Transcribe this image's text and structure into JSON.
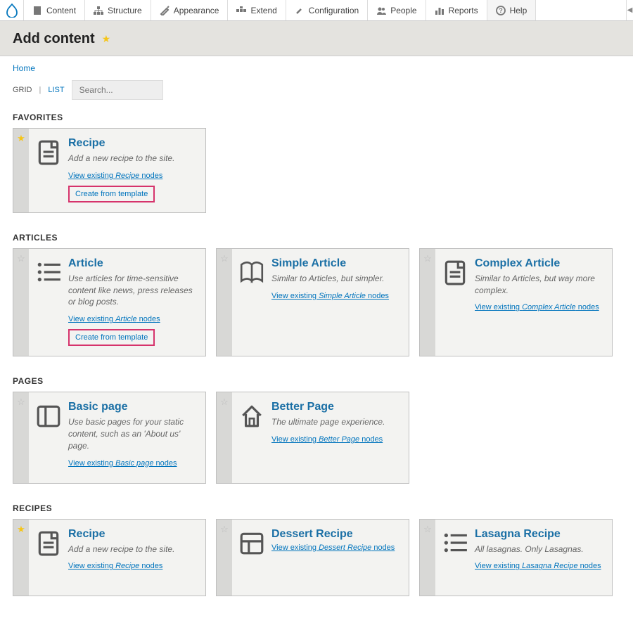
{
  "toolbar": {
    "items": [
      {
        "label": "Content",
        "icon": "file-icon"
      },
      {
        "label": "Structure",
        "icon": "structure-icon"
      },
      {
        "label": "Appearance",
        "icon": "appearance-icon"
      },
      {
        "label": "Extend",
        "icon": "extend-icon"
      },
      {
        "label": "Configuration",
        "icon": "config-icon"
      },
      {
        "label": "People",
        "icon": "people-icon"
      },
      {
        "label": "Reports",
        "icon": "reports-icon"
      },
      {
        "label": "Help",
        "icon": "help-icon"
      }
    ]
  },
  "page": {
    "title": "Add content",
    "breadcrumb_home": "Home",
    "view_grid": "GRID",
    "view_list": "LIST",
    "search_placeholder": "Search..."
  },
  "sections": [
    {
      "heading": "FAVORITES",
      "cards": [
        {
          "title": "Recipe",
          "desc": "Add a new recipe to the site.",
          "link_prefix": "View existing ",
          "link_em": "Recipe",
          "link_suffix": " nodes",
          "template": "Create from template",
          "favorited": true,
          "icon": "doc-icon"
        }
      ]
    },
    {
      "heading": "ARTICLES",
      "cards": [
        {
          "title": "Article",
          "desc": "Use articles for time-sensitive content like news, press releases or blog posts.",
          "link_prefix": "View existing ",
          "link_em": "Article",
          "link_suffix": " nodes",
          "template": "Create from template",
          "favorited": false,
          "icon": "list-icon"
        },
        {
          "title": "Simple Article",
          "desc": "Similar to Articles, but simpler.",
          "link_prefix": "View existing ",
          "link_em": "Simple Article",
          "link_suffix": " nodes",
          "favorited": false,
          "icon": "book-icon"
        },
        {
          "title": "Complex Article",
          "desc": "Similar to Articles, but way more complex.",
          "link_prefix": "View existing ",
          "link_em": "Complex Article",
          "link_suffix": " nodes",
          "favorited": false,
          "icon": "doc-icon"
        }
      ]
    },
    {
      "heading": "PAGES",
      "cards": [
        {
          "title": "Basic page",
          "desc": "Use basic pages for your static content, such as an 'About us' page.",
          "link_prefix": "View existing ",
          "link_em": "Basic page",
          "link_suffix": " nodes",
          "favorited": false,
          "icon": "panel-icon"
        },
        {
          "title": "Better Page",
          "desc": "The ultimate page experience.",
          "link_prefix": "View existing ",
          "link_em": "Better Page",
          "link_suffix": " nodes",
          "favorited": false,
          "icon": "home-icon"
        }
      ]
    },
    {
      "heading": "RECIPES",
      "cards": [
        {
          "title": "Recipe",
          "desc": "Add a new recipe to the site.",
          "link_prefix": "View existing ",
          "link_em": "Recipe",
          "link_suffix": " nodes",
          "favorited": true,
          "icon": "doc-icon"
        },
        {
          "title": "Dessert Recipe",
          "desc": "",
          "link_prefix": "View existing ",
          "link_em": "Dessert Recipe",
          "link_suffix": " nodes",
          "favorited": false,
          "icon": "grid-icon"
        },
        {
          "title": "Lasagna Recipe",
          "desc": "All lasagnas. Only Lasagnas.",
          "link_prefix": "View existing ",
          "link_em": "Lasagna Recipe",
          "link_suffix": " nodes",
          "favorited": false,
          "icon": "list-icon"
        }
      ]
    }
  ]
}
